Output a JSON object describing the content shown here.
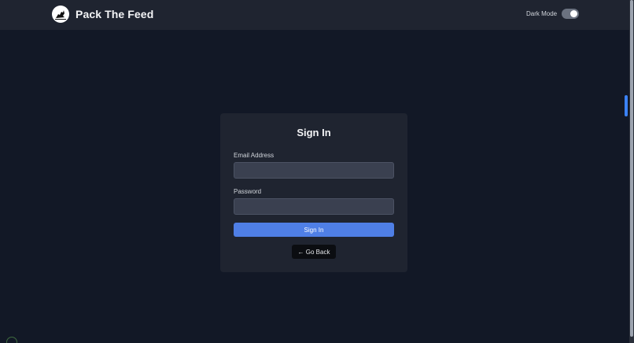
{
  "navbar": {
    "brand_name": "Pack The Feed",
    "logo_icon": "wolf-logo-icon",
    "dark_mode_label": "Dark Mode",
    "dark_mode_on": true
  },
  "signin": {
    "title": "Sign In",
    "email_label": "Email Address",
    "email_value": "",
    "password_label": "Password",
    "password_value": "",
    "submit_label": "Sign In",
    "back_label": "← Go Back"
  },
  "colors": {
    "background": "#121826",
    "card": "#1f2430",
    "primary": "#4f7fe6",
    "accent_indicator": "#3b82f6"
  }
}
